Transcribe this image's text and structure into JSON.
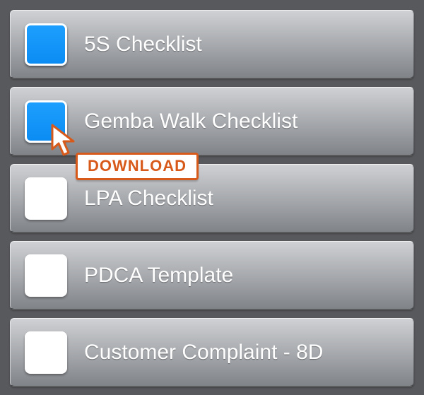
{
  "items": [
    {
      "label": "5S Checklist",
      "checked": true
    },
    {
      "label": "Gemba Walk Checklist",
      "checked": true
    },
    {
      "label": "LPA Checklist",
      "checked": false
    },
    {
      "label": "PDCA Template",
      "checked": false
    },
    {
      "label": "Customer Complaint - 8D",
      "checked": false
    }
  ],
  "tooltip": {
    "label": "DOWNLOAD"
  }
}
